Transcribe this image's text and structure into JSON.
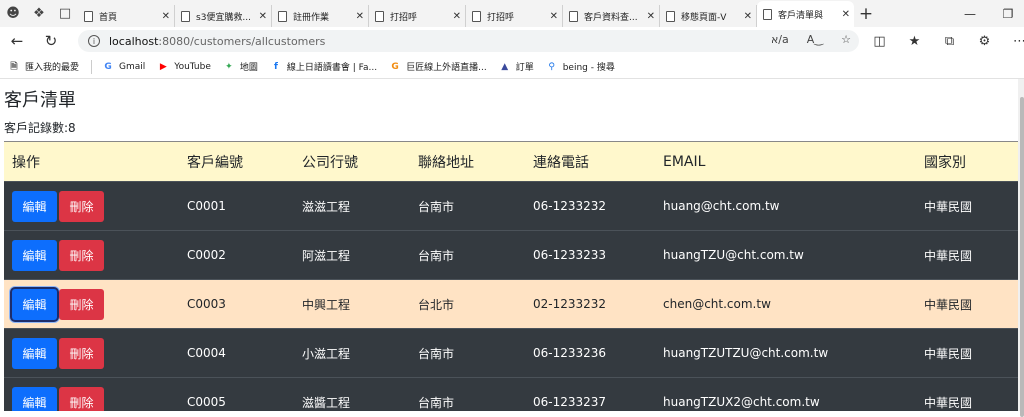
{
  "browser": {
    "tabs": [
      {
        "label": "首頁",
        "active": false
      },
      {
        "label": "s3便宜購救...",
        "active": false
      },
      {
        "label": "註冊作業",
        "active": false
      },
      {
        "label": "打招呼",
        "active": false
      },
      {
        "label": "打招呼",
        "active": false
      },
      {
        "label": "客戶資料查...",
        "active": false
      },
      {
        "label": "移態頁面-V",
        "active": false
      },
      {
        "label": "客戶清單與",
        "active": true
      }
    ],
    "new_tab_label": "+",
    "url_host": "localhost",
    "url_path": ":8080/customers/allcustomers",
    "bookmarks": [
      {
        "label": "匯入我的最愛",
        "icon": "folder-icon"
      },
      {
        "label": "Gmail",
        "icon": "google-icon"
      },
      {
        "label": "YouTube",
        "icon": "youtube-icon"
      },
      {
        "label": "地圖",
        "icon": "maps-icon"
      },
      {
        "label": "線上日語讀書會 | Fa...",
        "icon": "facebook-icon"
      },
      {
        "label": "巨匠線上外語直播...",
        "icon": "gjun-icon"
      },
      {
        "label": "訂單",
        "icon": "order-icon"
      },
      {
        "label": "being - 搜尋",
        "icon": "search-icon"
      }
    ]
  },
  "page": {
    "title": "客戶清單",
    "record_count": "客戶記錄數:8"
  },
  "table": {
    "headers": [
      "操作",
      "客戶編號",
      "公司行號",
      "聯絡地址",
      "連絡電話",
      "EMAIL",
      "國家別"
    ],
    "edit_label": "編輯",
    "delete_label": "刪除",
    "rows": [
      {
        "id": "C0001",
        "company": "滋滋工程",
        "address": "台南市",
        "phone": "06-1233232",
        "email": "huang@cht.com.tw",
        "country": "中華民國"
      },
      {
        "id": "C0002",
        "company": "阿滋工程",
        "address": "台南市",
        "phone": "06-1233233",
        "email": "huangTZU@cht.com.tw",
        "country": "中華民國"
      },
      {
        "id": "C0003",
        "company": "中興工程",
        "address": "台北市",
        "phone": "02-1233232",
        "email": "chen@cht.com.tw",
        "country": "中華民國"
      },
      {
        "id": "C0004",
        "company": "小滋工程",
        "address": "台南市",
        "phone": "06-1233236",
        "email": "huangTZUTZU@cht.com.tw",
        "country": "中華民國"
      },
      {
        "id": "C0005",
        "company": "滋醬工程",
        "address": "台南市",
        "phone": "06-1233237",
        "email": "huangTZUX2@cht.com.tw",
        "country": "中華民國"
      }
    ]
  },
  "colors": {
    "header_bg": "#fff8cc",
    "row_bg": "#343a40",
    "row_highlight_bg": "#ffe3c4",
    "edit_button": "#0d6efd",
    "delete_button": "#dc3545"
  }
}
